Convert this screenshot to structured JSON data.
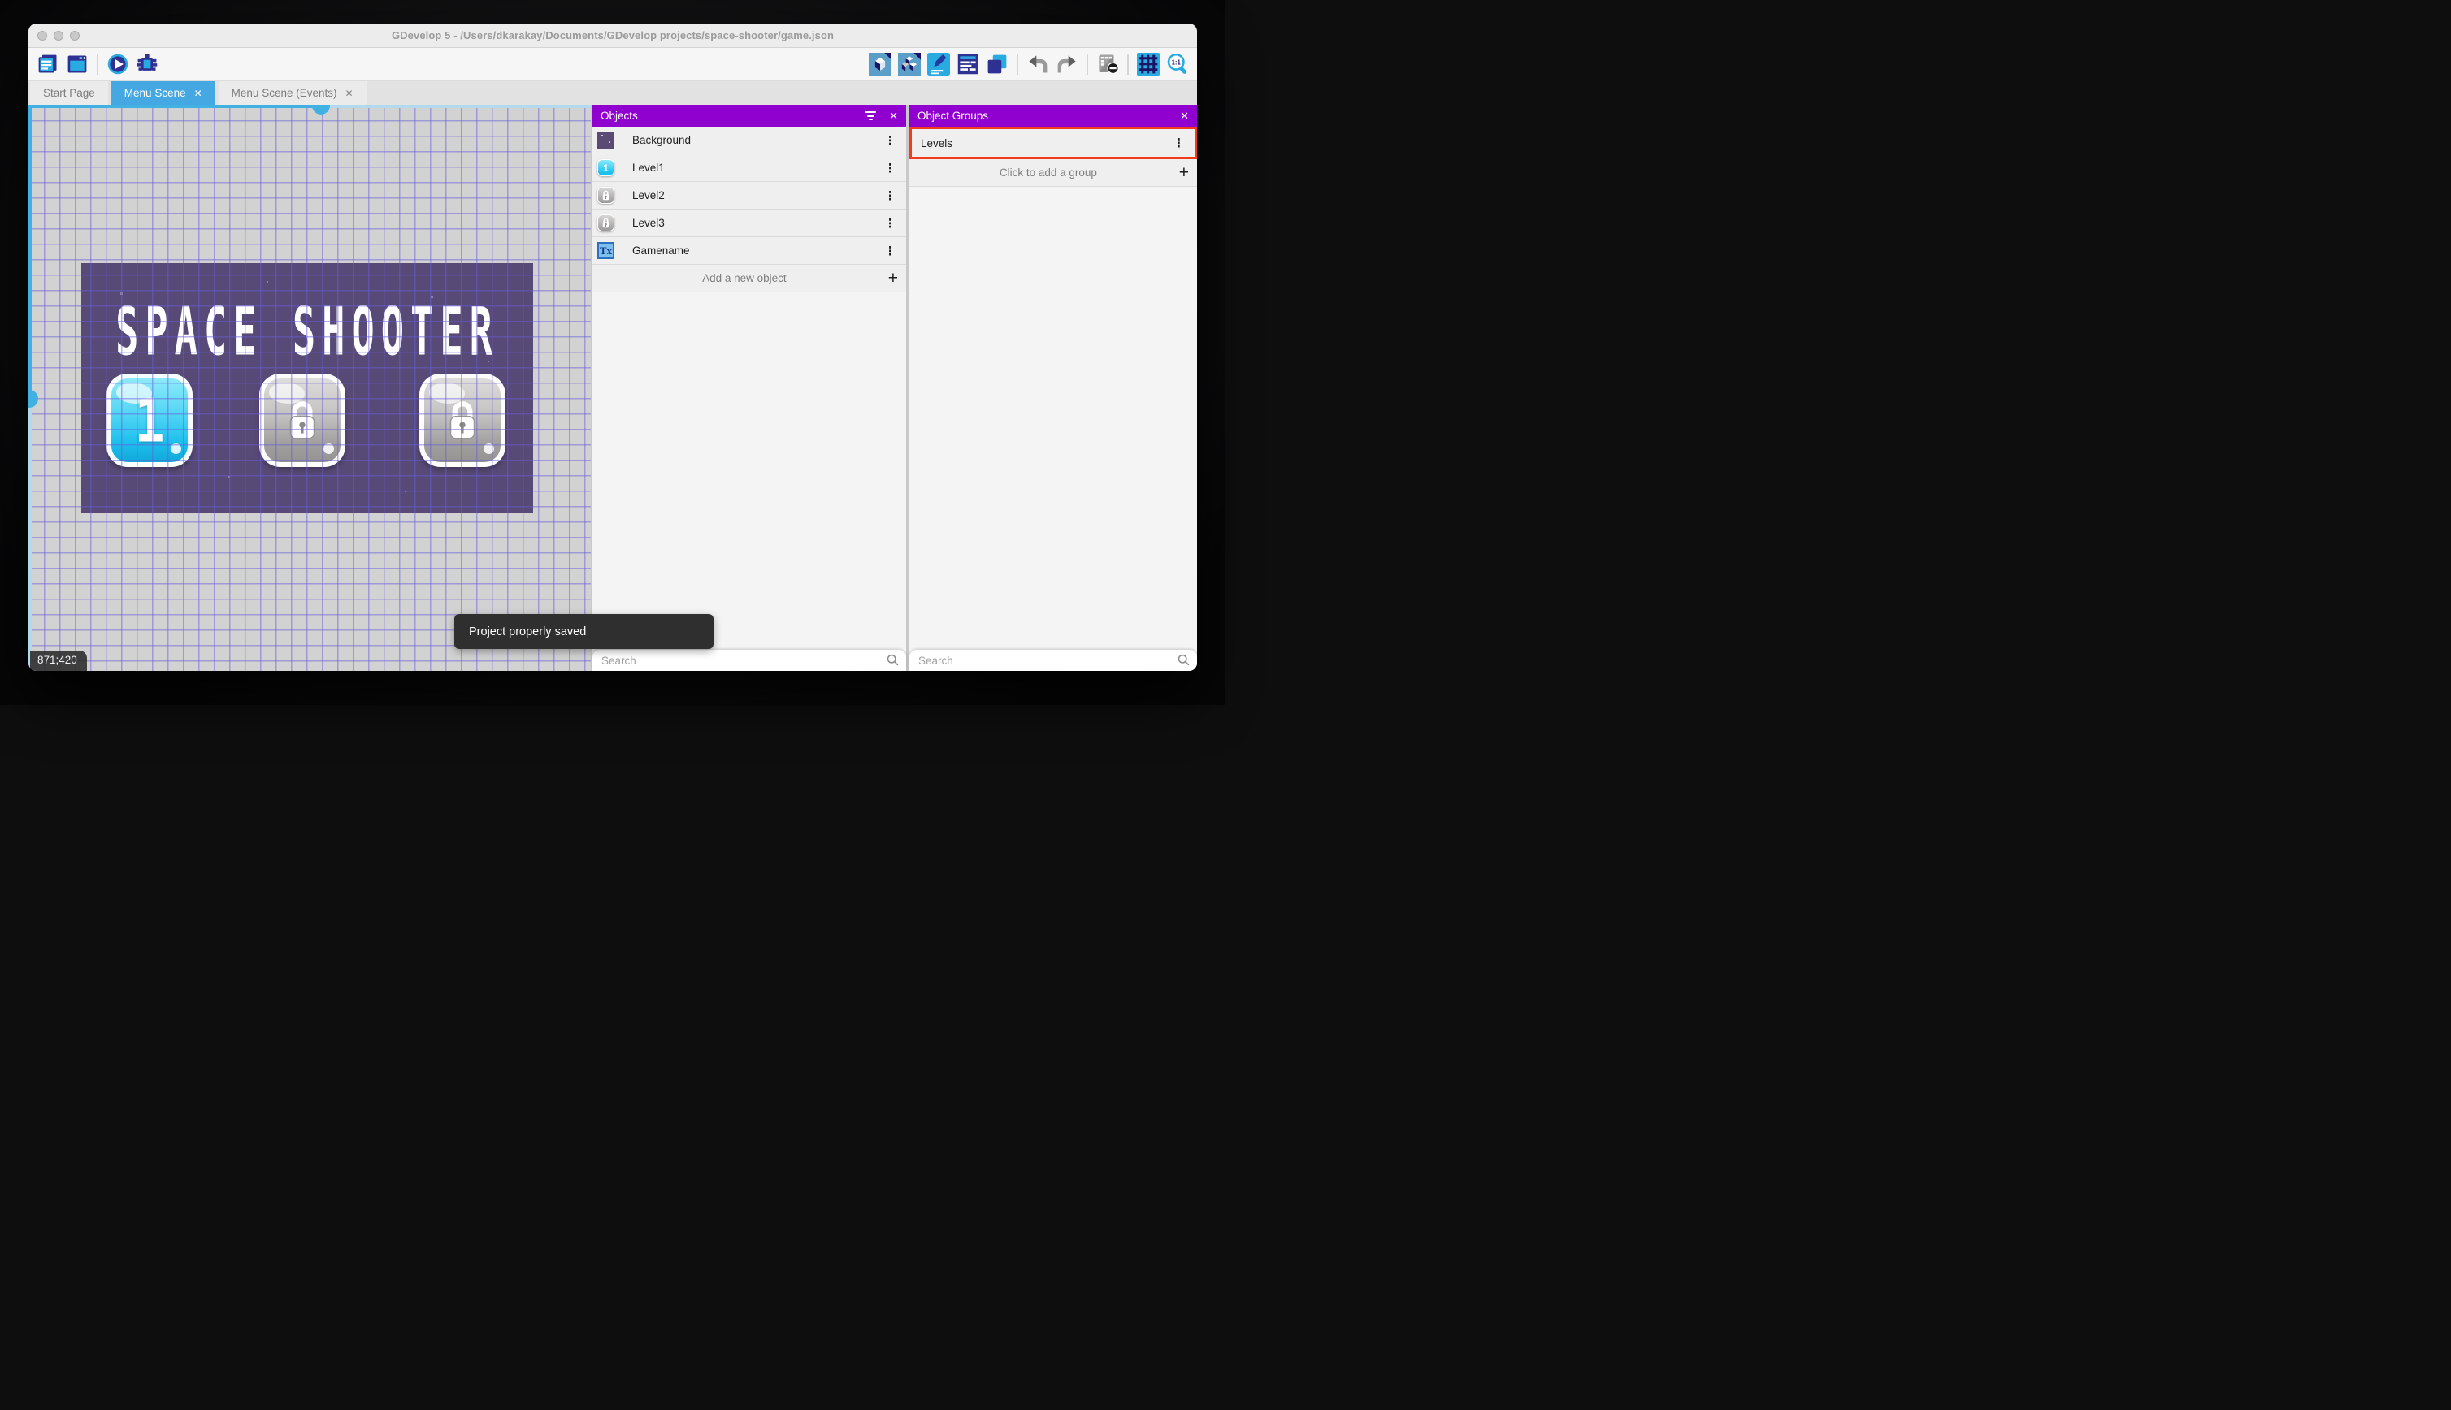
{
  "window": {
    "title": "GDevelop 5 - /Users/dkarakay/Documents/GDevelop projects/space-shooter/game.json"
  },
  "toolbar": {
    "left_icons": [
      "project-manager",
      "scene-editor",
      "preview-play",
      "debugger"
    ],
    "right_icons": [
      "objects-editor",
      "object-groups",
      "properties",
      "instances-list",
      "layers",
      "undo",
      "redo",
      "mask-preview",
      "grid",
      "zoom-1-1"
    ],
    "zoom_ratio": "1:1"
  },
  "tabs": [
    {
      "label": "Start Page",
      "active": false,
      "closable": false
    },
    {
      "label": "Menu Scene",
      "active": true,
      "closable": true
    },
    {
      "label": "Menu Scene (Events)",
      "active": false,
      "closable": true
    }
  ],
  "canvas": {
    "scene_title": "SPACE SHOOTER",
    "level1_label": "1",
    "coordinates": "871;420"
  },
  "objects_panel": {
    "title": "Objects",
    "rows": [
      {
        "label": "Background"
      },
      {
        "label": "Level1"
      },
      {
        "label": "Level2"
      },
      {
        "label": "Level3"
      },
      {
        "label": "Gamename",
        "icon_glyph": "Tx"
      }
    ],
    "add_label": "Add a new object",
    "search_placeholder": "Search"
  },
  "groups_panel": {
    "title": "Object Groups",
    "rows": [
      {
        "label": "Levels",
        "highlighted": true
      }
    ],
    "add_label": "Click to add a group",
    "search_placeholder": "Search"
  },
  "toast": {
    "message": "Project properly saved"
  },
  "glyphs": {
    "close": "✕",
    "kebab": "⋮",
    "plus": "+"
  },
  "colors": {
    "header_purple": "#9000CE",
    "active_tab_blue": "#45A8E2",
    "scrollbar_blue": "#41B1E3",
    "highlight_red": "#F43B1C",
    "scene_background": "#584A76",
    "toast_dark": "#2F2F2F",
    "icon_navy": "#2E3192",
    "icon_blue": "#29ABE2"
  }
}
